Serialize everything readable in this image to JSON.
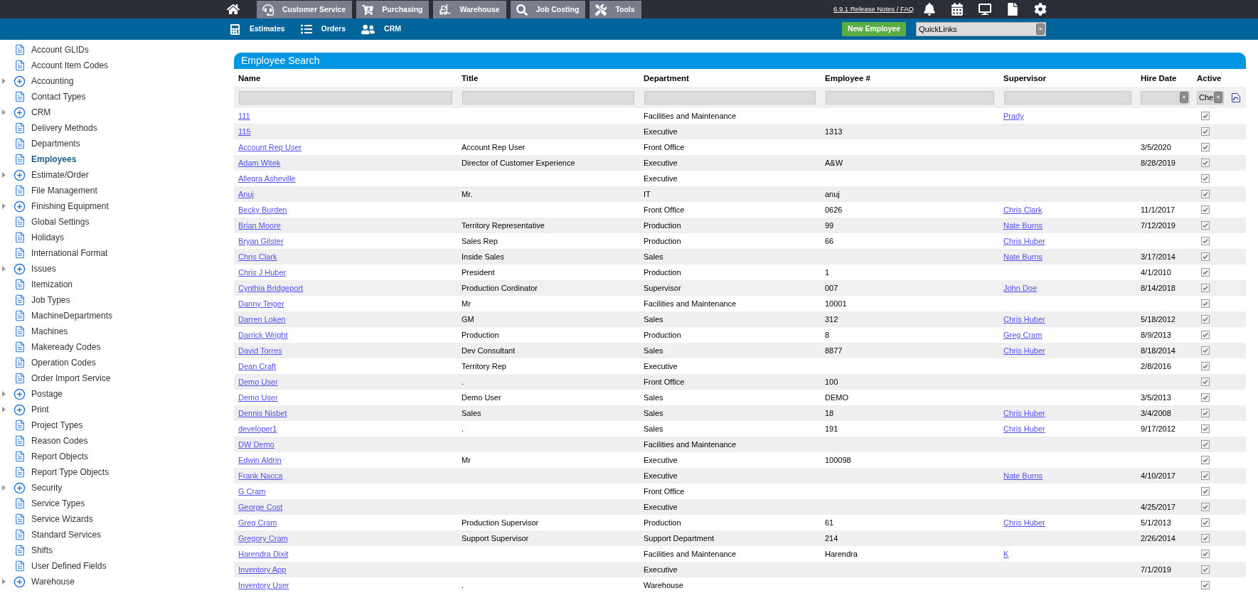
{
  "top_nav": {
    "tabs": [
      "Customer Service",
      "Purchasing",
      "Warehouse",
      "Job Costing",
      "Tools"
    ],
    "release_link": "6.9.1 Release Notes / FAQ"
  },
  "sub_nav": {
    "links": [
      "Estimates",
      "Orders",
      "CRM"
    ],
    "new_button": "New Employee",
    "quicklinks": {
      "value": "QuickLinks"
    }
  },
  "sidebar": {
    "items": [
      {
        "label": "Account GLIDs",
        "kind": "page",
        "selected": false
      },
      {
        "label": "Account Item Codes",
        "kind": "page",
        "selected": false
      },
      {
        "label": "Accounting",
        "kind": "folder",
        "selected": false,
        "expanded": false
      },
      {
        "label": "Contact Types",
        "kind": "page",
        "selected": false
      },
      {
        "label": "CRM",
        "kind": "folder",
        "selected": false,
        "expanded": false
      },
      {
        "label": "Delivery Methods",
        "kind": "page",
        "selected": false
      },
      {
        "label": "Departments",
        "kind": "page",
        "selected": false
      },
      {
        "label": "Employees",
        "kind": "page",
        "selected": true
      },
      {
        "label": "Estimate/Order",
        "kind": "folder",
        "selected": false,
        "expanded": false
      },
      {
        "label": "File Management",
        "kind": "page",
        "selected": false
      },
      {
        "label": "Finishing Equipment",
        "kind": "folder",
        "selected": false,
        "expanded": false
      },
      {
        "label": "Global Settings",
        "kind": "page",
        "selected": false
      },
      {
        "label": "Holidays",
        "kind": "page",
        "selected": false
      },
      {
        "label": "International Format",
        "kind": "page",
        "selected": false
      },
      {
        "label": "Issues",
        "kind": "folder",
        "selected": false,
        "expanded": false
      },
      {
        "label": "Itemization",
        "kind": "page",
        "selected": false
      },
      {
        "label": "Job Types",
        "kind": "page",
        "selected": false
      },
      {
        "label": "MachineDepartments",
        "kind": "page",
        "selected": false
      },
      {
        "label": "Machines",
        "kind": "page",
        "selected": false
      },
      {
        "label": "Makeready Codes",
        "kind": "page",
        "selected": false
      },
      {
        "label": "Operation Codes",
        "kind": "page",
        "selected": false
      },
      {
        "label": "Order Import Service",
        "kind": "page",
        "selected": false
      },
      {
        "label": "Postage",
        "kind": "folder",
        "selected": false,
        "expanded": false
      },
      {
        "label": "Print",
        "kind": "folder",
        "selected": false,
        "expanded": false
      },
      {
        "label": "Project Types",
        "kind": "page",
        "selected": false
      },
      {
        "label": "Reason Codes",
        "kind": "page",
        "selected": false
      },
      {
        "label": "Report Objects",
        "kind": "page",
        "selected": false
      },
      {
        "label": "Report Type Objects",
        "kind": "page",
        "selected": false
      },
      {
        "label": "Security",
        "kind": "folder",
        "selected": false,
        "expanded": false
      },
      {
        "label": "Service Types",
        "kind": "page",
        "selected": false
      },
      {
        "label": "Service Wizards",
        "kind": "page",
        "selected": false
      },
      {
        "label": "Standard Services",
        "kind": "page",
        "selected": false
      },
      {
        "label": "Shifts",
        "kind": "page",
        "selected": false
      },
      {
        "label": "User Defined Fields",
        "kind": "page",
        "selected": false
      },
      {
        "label": "Warehouse",
        "kind": "folder",
        "selected": false,
        "expanded": false
      }
    ]
  },
  "panel": {
    "title": "Employee Search",
    "table": {
      "columns": [
        "Name",
        "Title",
        "Department",
        "Employee #",
        "Supervisor",
        "Hire Date",
        "Active"
      ],
      "filters": [
        {
          "kind": "text"
        },
        {
          "kind": "text"
        },
        {
          "kind": "text"
        },
        {
          "kind": "text"
        },
        {
          "kind": "text"
        },
        {
          "kind": "select"
        },
        {
          "kind": "select",
          "value": "Che"
        }
      ],
      "rows": [
        {
          "name": "111",
          "department": "Facilities and Maintenance",
          "supervisor": "Prady",
          "active": true
        },
        {
          "name": "115",
          "department": "Executive",
          "employee_no": "1313",
          "active": true
        },
        {
          "name": "Account Rep User",
          "title": "Account Rep User",
          "department": "Front Office",
          "hire_date": "3/5/2020",
          "active": true
        },
        {
          "name": "Adam Witek",
          "title": "Director of Customer Experience",
          "department": "Executive",
          "employee_no": "A&W",
          "hire_date": "8/28/2019",
          "active": true
        },
        {
          "name": "Allegra Asheville",
          "department": "Executive",
          "active": true
        },
        {
          "name": "Anuj",
          "title": "Mr.",
          "department": "IT",
          "employee_no": "anuj",
          "active": true
        },
        {
          "name": "Becky Burden",
          "department": "Front Office",
          "employee_no": "0626",
          "supervisor": "Chris Clark",
          "hire_date": "11/1/2017",
          "active": true
        },
        {
          "name": "Brian Moore",
          "title": "Territory Representative",
          "department": "Production",
          "employee_no": "99",
          "supervisor": "Nate Burns",
          "hire_date": "7/12/2019",
          "active": true
        },
        {
          "name": "Bryan Gilster",
          "title": "Sales Rep",
          "department": "Production",
          "employee_no": "66",
          "supervisor": "Chris Huber",
          "active": true
        },
        {
          "name": "Chris Clark",
          "title": "Inside Sales",
          "department": "Sales",
          "supervisor": "Nate Burns",
          "hire_date": "3/17/2014",
          "active": true
        },
        {
          "name": "Chris J Huber",
          "title": "President",
          "department": "Production",
          "employee_no": "1",
          "hire_date": "4/1/2010",
          "active": true
        },
        {
          "name": "Cynthia Bridgeport",
          "title": "Production Cordinator",
          "department": "Supervisor",
          "employee_no": "007",
          "supervisor": "John Doe",
          "hire_date": "8/14/2018",
          "active": true
        },
        {
          "name": "Danny Teiger",
          "title": "Mr",
          "department": "Facilities and Maintenance",
          "employee_no": "10001",
          "active": true
        },
        {
          "name": "Darren Loken",
          "title": "GM",
          "department": "Sales",
          "employee_no": "312",
          "supervisor": "Chris Huber",
          "hire_date": "5/18/2012",
          "active": true
        },
        {
          "name": "Darrick Wright",
          "title": "Production",
          "department": "Production",
          "employee_no": "8",
          "supervisor": "Greg Cram",
          "hire_date": "8/9/2013",
          "active": true
        },
        {
          "name": "David Torres",
          "title": "Dev Consultant",
          "department": "Sales",
          "employee_no": "8877",
          "supervisor": "Chris Huber",
          "hire_date": "8/18/2014",
          "active": true
        },
        {
          "name": "Dean Craft",
          "title": "Territory Rep",
          "department": "Executive",
          "hire_date": "2/8/2016",
          "active": true
        },
        {
          "name": "Demo User",
          "title": ".",
          "department": "Front Office",
          "employee_no": "100",
          "active": true
        },
        {
          "name": "Demo User",
          "title": "Demo User",
          "department": "Sales",
          "employee_no": "DEMO",
          "hire_date": "3/5/2013",
          "active": true
        },
        {
          "name": "Dennis Nisbet",
          "title": "Sales",
          "department": "Sales",
          "employee_no": "18",
          "supervisor": "Chris Huber",
          "hire_date": "3/4/2008",
          "active": true
        },
        {
          "name": "developer1",
          "title": ".",
          "department": "Sales",
          "employee_no": "191",
          "supervisor": "Chris Huber",
          "hire_date": "9/17/2012",
          "active": true
        },
        {
          "name": "DW Demo",
          "department": "Facilities and Maintenance",
          "active": true
        },
        {
          "name": "Edwin Aldrin",
          "title": "Mr",
          "department": "Executive",
          "employee_no": "100098",
          "active": true
        },
        {
          "name": "Frank Nacca",
          "department": "Executive",
          "supervisor": "Nate Burns",
          "hire_date": "4/10/2017",
          "active": true
        },
        {
          "name": "G Cram",
          "department": "Front Office",
          "active": true
        },
        {
          "name": "George Cost",
          "department": "Executive",
          "hire_date": "4/25/2017",
          "active": true
        },
        {
          "name": "Greg Cram",
          "title": "Production Supervisor",
          "department": "Production",
          "employee_no": "61",
          "supervisor": "Chris Huber",
          "hire_date": "5/1/2013",
          "active": true
        },
        {
          "name": "Gregory Cram",
          "title": "Support Supervisor",
          "department": "Support Department",
          "employee_no": "214",
          "hire_date": "2/26/2014",
          "active": true
        },
        {
          "name": "Harendra Dixit",
          "department": "Facilities and Maintenance",
          "employee_no": "Harendra",
          "supervisor": "K",
          "active": true
        },
        {
          "name": "Inventory App",
          "department": "Executive",
          "hire_date": "7/1/2019",
          "active": true
        },
        {
          "name": "Inventory User",
          "title": ".",
          "department": "Warehouse",
          "active": true
        }
      ]
    }
  }
}
